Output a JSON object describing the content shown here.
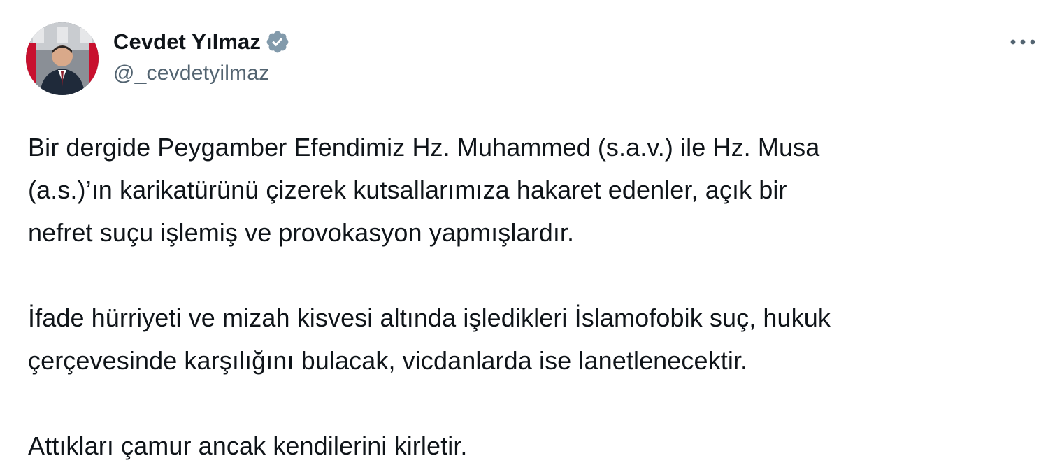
{
  "author": {
    "display_name": "Cevdet Yılmaz",
    "handle": "@_cevdetyilmaz",
    "verified_badge_color": "#829aab"
  },
  "actions": {
    "more_label": "···"
  },
  "tweet": {
    "paragraphs": [
      "Bir dergide Peygamber Efendimiz Hz. Muhammed (s.a.v.) ile Hz. Musa\n(a.s.)’ın karikatürünü çizerek kutsallarımıza hakaret edenler, açık bir\nnefret suçu işlemiş ve provokasyon yapmışlardır.",
      "İfade hürriyeti ve mizah kisvesi altında işledikleri İslamofobik suç, hukuk\nçerçevesinde karşılığını bulacak, vicdanlarda ise lanetlenecektir.",
      "Attıkları çamur ancak kendilerini kirletir."
    ]
  },
  "colors": {
    "text_primary": "#0f1419",
    "text_secondary": "#536471",
    "background": "#ffffff"
  }
}
